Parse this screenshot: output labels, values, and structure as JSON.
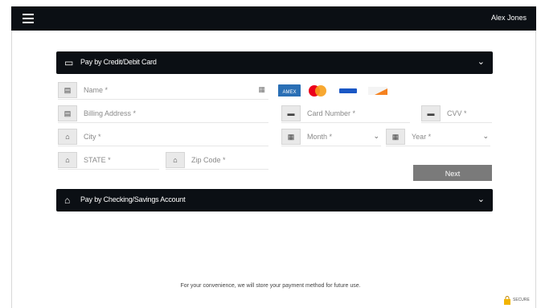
{
  "header": {
    "user_name": "Alex Jones"
  },
  "card_panel": {
    "title": "Pay by Credit/Debit Card",
    "fields": {
      "name": "Name *",
      "billing_address": "Billing Address *",
      "city": "City *",
      "state": "STATE *",
      "zip": "Zip Code *",
      "card_number": "Card Number *",
      "cvv": "CVV *",
      "month": "Month *",
      "year": "Year *"
    },
    "card_brands": [
      "amex",
      "mastercard",
      "visa",
      "discover"
    ],
    "next_label": "Next"
  },
  "bank_panel": {
    "title": "Pay by Checking/Savings Account"
  },
  "footer": {
    "note": "For your convenience, we will store your payment method for future use.",
    "secure_badge": "SECURE"
  }
}
